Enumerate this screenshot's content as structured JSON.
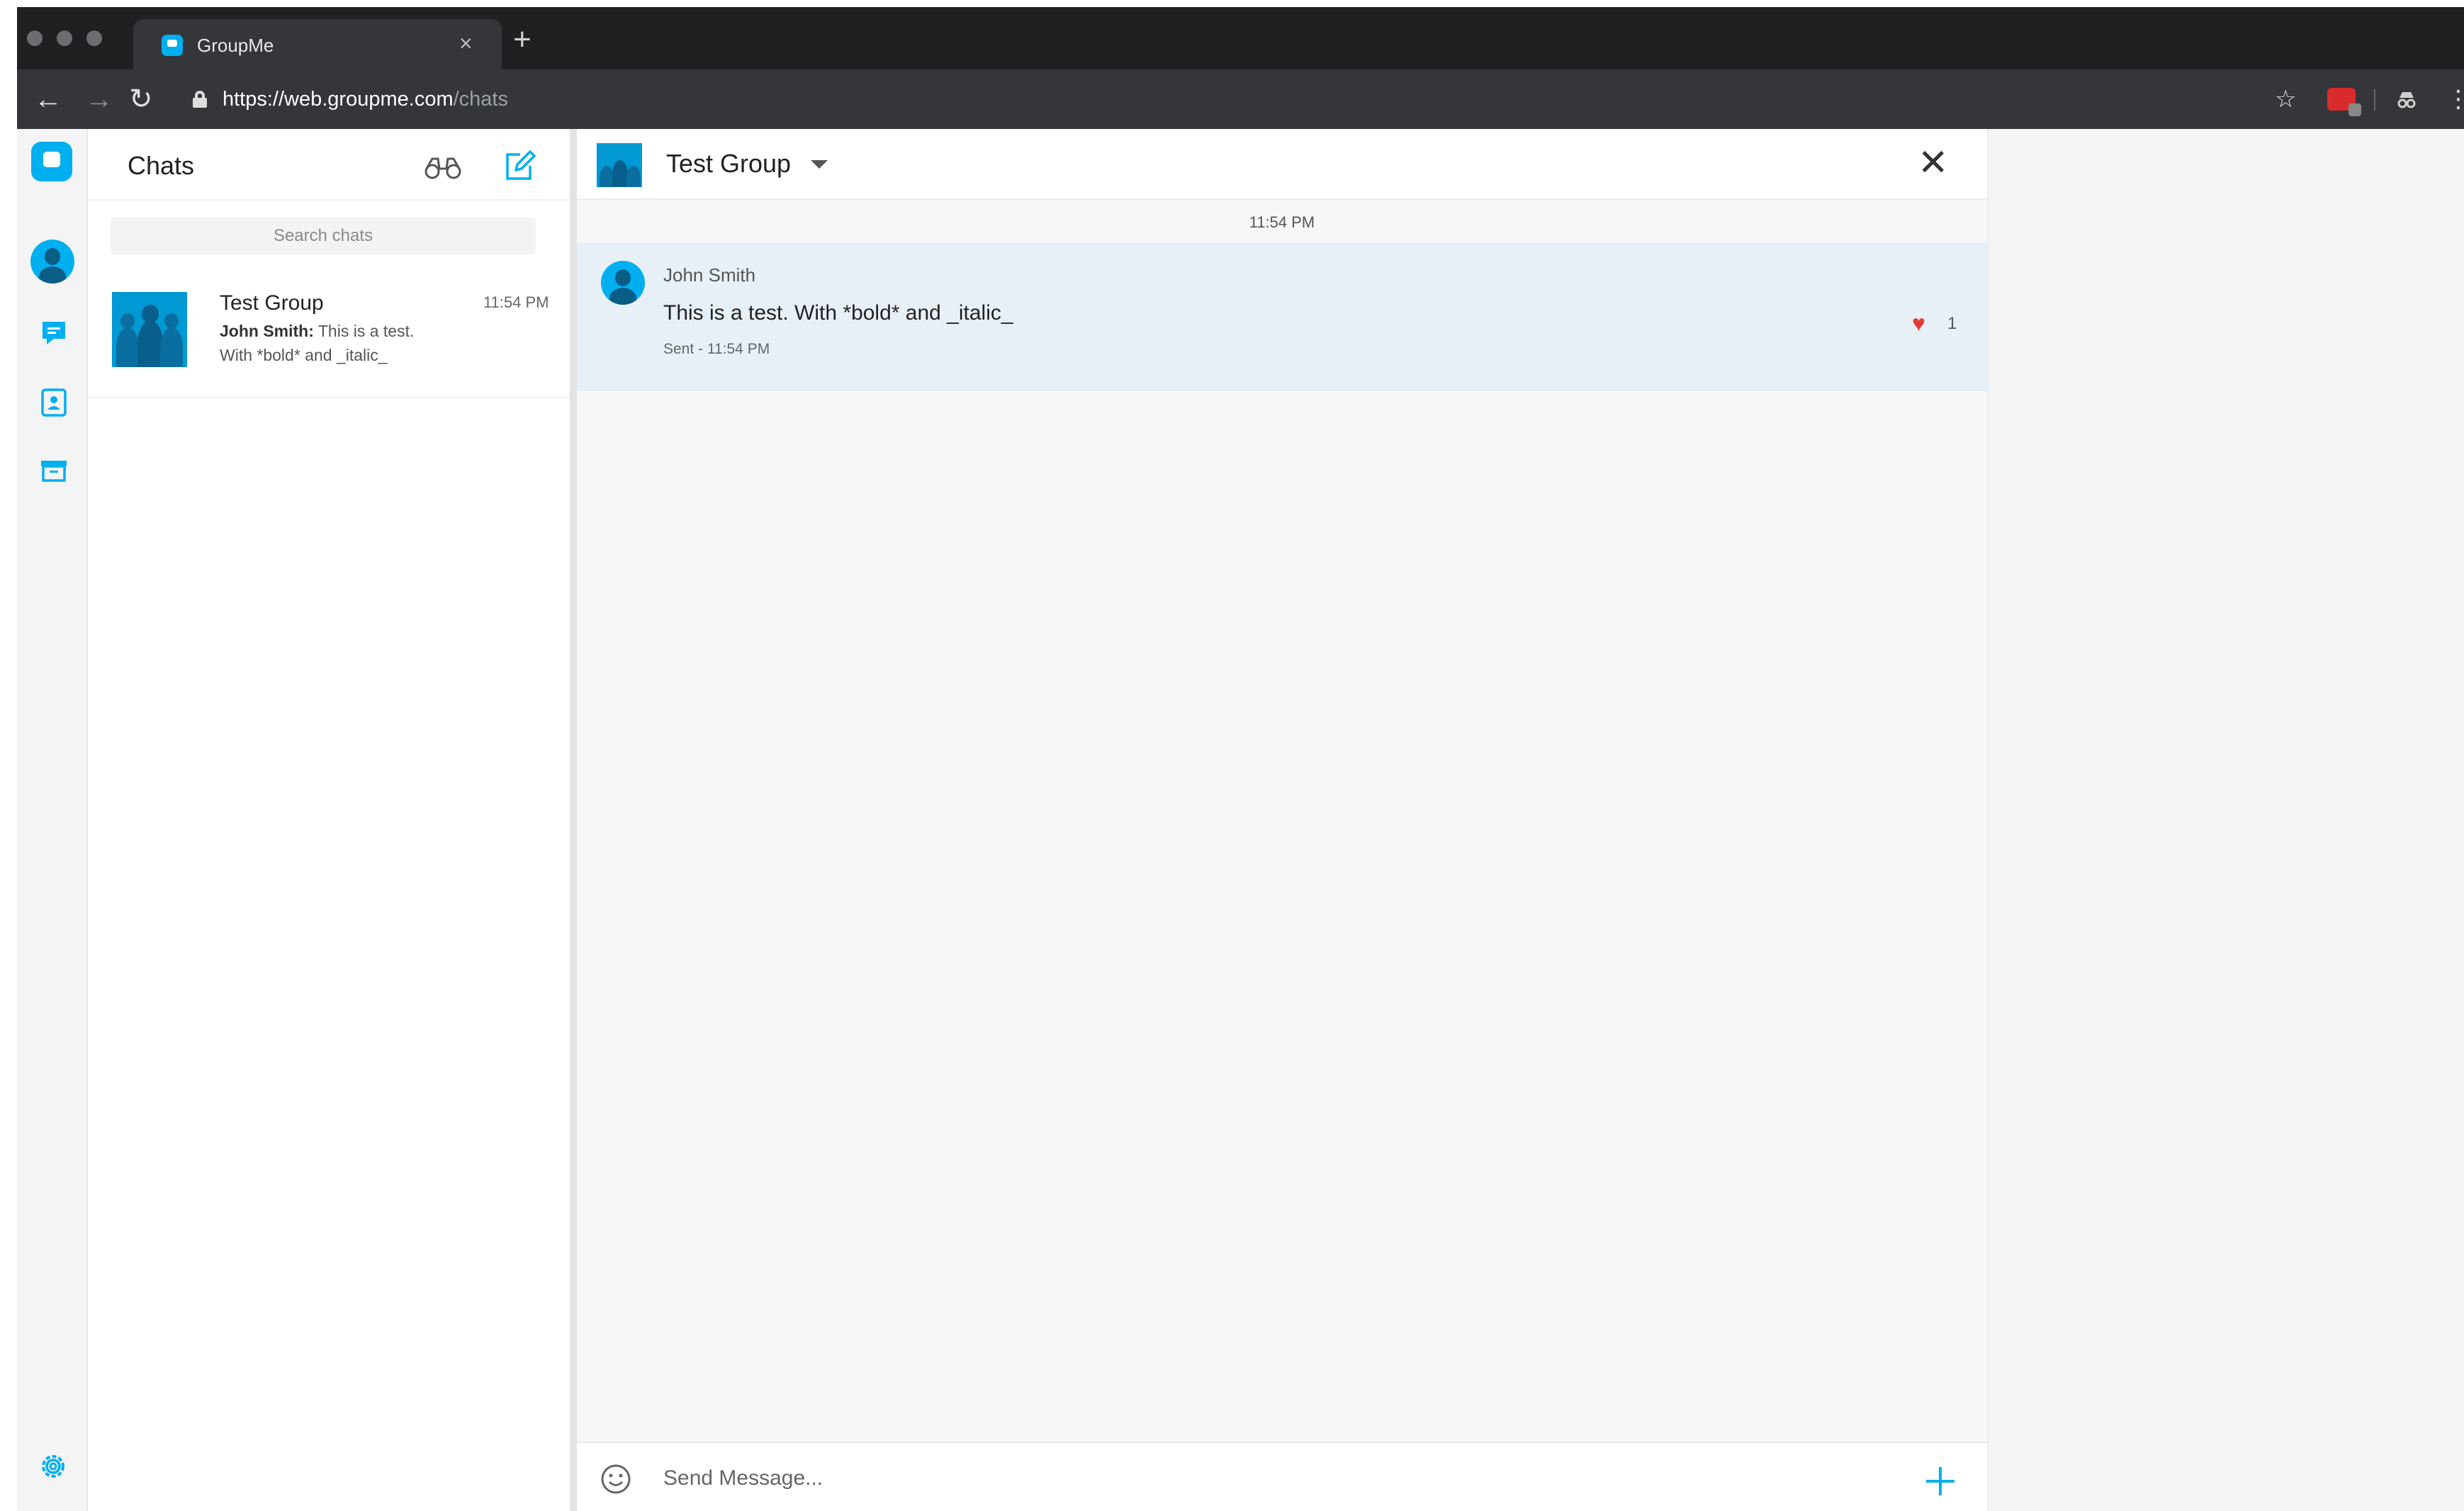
{
  "browser": {
    "tab_title": "GroupMe",
    "tab_close": "×",
    "new_tab": "+",
    "back": "←",
    "forward": "→",
    "reload": "↻",
    "url_host": "https://web.groupme.com",
    "url_path": "/chats",
    "bookmark": "☆",
    "menu": "⋮"
  },
  "sidebar": {
    "title": "Chats",
    "search_placeholder": "Search chats"
  },
  "chats": [
    {
      "name": "Test Group",
      "time": "11:54 PM",
      "preview_author": "John Smith:",
      "preview_line1": "This is a test.",
      "preview_line2": "With *bold* and _italic_"
    }
  ],
  "conversation": {
    "title": "Test Group",
    "close": "✕",
    "timestamp": "11:54 PM",
    "message": {
      "author": "John Smith",
      "text": "This is a test. With *bold* and _italic_",
      "status": "Sent - 11:54 PM",
      "likes": "1",
      "heart": "♥"
    },
    "composer_placeholder": "Send Message..."
  },
  "icons": {
    "nav": [
      "groupme-logo-icon",
      "profile-avatar",
      "chats-icon",
      "contacts-icon",
      "archive-icon",
      "settings-icon"
    ],
    "header": [
      "binoculars-icon",
      "compose-icon",
      "chevron-down-icon",
      "close-icon"
    ],
    "composer": [
      "emoji-icon",
      "plus-icon"
    ]
  },
  "colors": {
    "accent": "#00aff0",
    "selected_message_bg": "#e8f0f7",
    "like": "#e53935",
    "chrome_dark": "#1f2022"
  }
}
